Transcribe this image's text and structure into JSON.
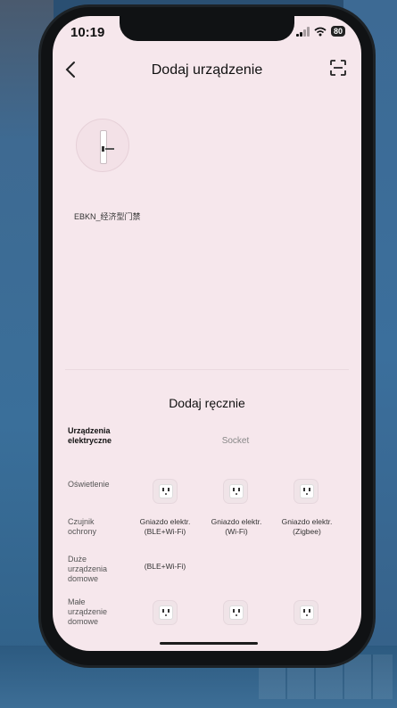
{
  "status": {
    "time": "10:19",
    "battery": "80"
  },
  "header": {
    "title": "Dodaj urządzenie"
  },
  "discovered": {
    "device_name": "EBKN_经济型门禁"
  },
  "manual": {
    "title": "Dodaj ręcznie",
    "categories": [
      {
        "label": "Urządzenia elektryczne"
      },
      {
        "label": "Oświetlenie"
      },
      {
        "label": "Czujnik ochrony"
      },
      {
        "label": "Duże urządzenia domowe"
      },
      {
        "label": "Małe urządzenie domowe"
      }
    ],
    "section_label": "Socket",
    "products": [
      {
        "label": "Gniazdo elektr. (BLE+Wi-Fi)"
      },
      {
        "label": "Gniazdo elektr. (Wi-Fi)"
      },
      {
        "label": "Gniazdo elektr. (Zigbee)"
      },
      {
        "label": "(BLE+Wi-Fi)"
      }
    ]
  },
  "colors": {
    "screen_bg": "#f6e7ec",
    "accent_text": "#111111"
  }
}
